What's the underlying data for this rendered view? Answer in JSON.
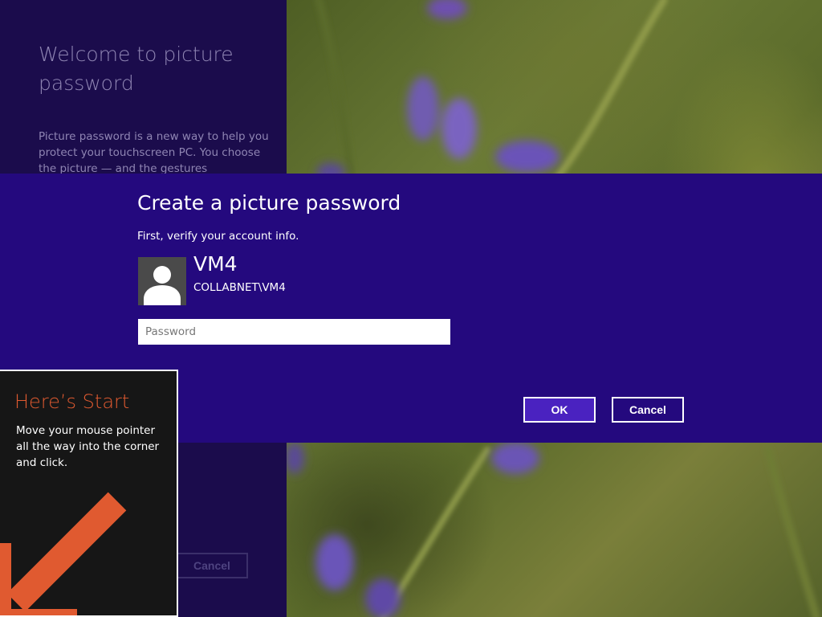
{
  "intro": {
    "title": "Welcome to picture password",
    "description": "Picture password is a new way to help you protect your touchscreen PC. You choose the picture — and the gestures",
    "cancel_label": "Cancel"
  },
  "dialog": {
    "title": "Create a picture password",
    "subtitle": "First, verify your account info.",
    "user": {
      "name": "VM4",
      "account": "COLLABNET\\VM4"
    },
    "password": {
      "placeholder": "Password",
      "value": ""
    },
    "ok_label": "OK",
    "cancel_label": "Cancel"
  },
  "start_tip": {
    "title": "Here’s Start",
    "body": "Move your mouse pointer all the way into the corner and click."
  },
  "colors": {
    "dialog_background": "#24097e",
    "ok_button": "#4a22c0",
    "start_title": "#e05a30",
    "start_arrow": "#e05a30"
  },
  "icons": {
    "avatar": "user-silhouette-icon",
    "tip_arrow": "arrow-down-left-icon"
  }
}
